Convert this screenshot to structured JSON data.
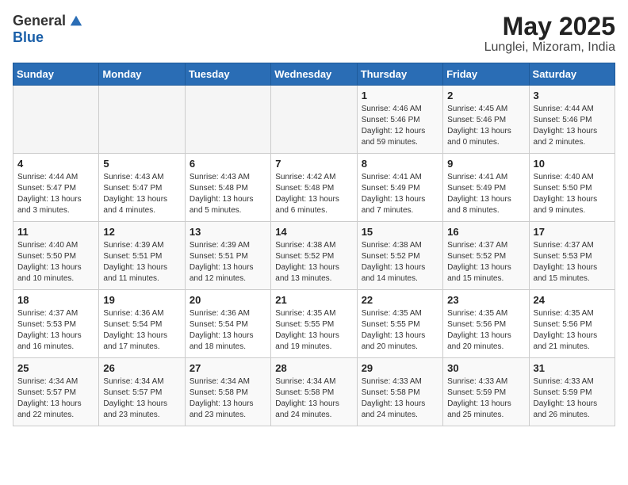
{
  "header": {
    "logo_general": "General",
    "logo_blue": "Blue",
    "month_title": "May 2025",
    "location": "Lunglei, Mizoram, India"
  },
  "weekdays": [
    "Sunday",
    "Monday",
    "Tuesday",
    "Wednesday",
    "Thursday",
    "Friday",
    "Saturday"
  ],
  "weeks": [
    [
      {
        "day": "",
        "info": ""
      },
      {
        "day": "",
        "info": ""
      },
      {
        "day": "",
        "info": ""
      },
      {
        "day": "",
        "info": ""
      },
      {
        "day": "1",
        "info": "Sunrise: 4:46 AM\nSunset: 5:46 PM\nDaylight: 12 hours\nand 59 minutes."
      },
      {
        "day": "2",
        "info": "Sunrise: 4:45 AM\nSunset: 5:46 PM\nDaylight: 13 hours\nand 0 minutes."
      },
      {
        "day": "3",
        "info": "Sunrise: 4:44 AM\nSunset: 5:46 PM\nDaylight: 13 hours\nand 2 minutes."
      }
    ],
    [
      {
        "day": "4",
        "info": "Sunrise: 4:44 AM\nSunset: 5:47 PM\nDaylight: 13 hours\nand 3 minutes."
      },
      {
        "day": "5",
        "info": "Sunrise: 4:43 AM\nSunset: 5:47 PM\nDaylight: 13 hours\nand 4 minutes."
      },
      {
        "day": "6",
        "info": "Sunrise: 4:43 AM\nSunset: 5:48 PM\nDaylight: 13 hours\nand 5 minutes."
      },
      {
        "day": "7",
        "info": "Sunrise: 4:42 AM\nSunset: 5:48 PM\nDaylight: 13 hours\nand 6 minutes."
      },
      {
        "day": "8",
        "info": "Sunrise: 4:41 AM\nSunset: 5:49 PM\nDaylight: 13 hours\nand 7 minutes."
      },
      {
        "day": "9",
        "info": "Sunrise: 4:41 AM\nSunset: 5:49 PM\nDaylight: 13 hours\nand 8 minutes."
      },
      {
        "day": "10",
        "info": "Sunrise: 4:40 AM\nSunset: 5:50 PM\nDaylight: 13 hours\nand 9 minutes."
      }
    ],
    [
      {
        "day": "11",
        "info": "Sunrise: 4:40 AM\nSunset: 5:50 PM\nDaylight: 13 hours\nand 10 minutes."
      },
      {
        "day": "12",
        "info": "Sunrise: 4:39 AM\nSunset: 5:51 PM\nDaylight: 13 hours\nand 11 minutes."
      },
      {
        "day": "13",
        "info": "Sunrise: 4:39 AM\nSunset: 5:51 PM\nDaylight: 13 hours\nand 12 minutes."
      },
      {
        "day": "14",
        "info": "Sunrise: 4:38 AM\nSunset: 5:52 PM\nDaylight: 13 hours\nand 13 minutes."
      },
      {
        "day": "15",
        "info": "Sunrise: 4:38 AM\nSunset: 5:52 PM\nDaylight: 13 hours\nand 14 minutes."
      },
      {
        "day": "16",
        "info": "Sunrise: 4:37 AM\nSunset: 5:52 PM\nDaylight: 13 hours\nand 15 minutes."
      },
      {
        "day": "17",
        "info": "Sunrise: 4:37 AM\nSunset: 5:53 PM\nDaylight: 13 hours\nand 15 minutes."
      }
    ],
    [
      {
        "day": "18",
        "info": "Sunrise: 4:37 AM\nSunset: 5:53 PM\nDaylight: 13 hours\nand 16 minutes."
      },
      {
        "day": "19",
        "info": "Sunrise: 4:36 AM\nSunset: 5:54 PM\nDaylight: 13 hours\nand 17 minutes."
      },
      {
        "day": "20",
        "info": "Sunrise: 4:36 AM\nSunset: 5:54 PM\nDaylight: 13 hours\nand 18 minutes."
      },
      {
        "day": "21",
        "info": "Sunrise: 4:35 AM\nSunset: 5:55 PM\nDaylight: 13 hours\nand 19 minutes."
      },
      {
        "day": "22",
        "info": "Sunrise: 4:35 AM\nSunset: 5:55 PM\nDaylight: 13 hours\nand 20 minutes."
      },
      {
        "day": "23",
        "info": "Sunrise: 4:35 AM\nSunset: 5:56 PM\nDaylight: 13 hours\nand 20 minutes."
      },
      {
        "day": "24",
        "info": "Sunrise: 4:35 AM\nSunset: 5:56 PM\nDaylight: 13 hours\nand 21 minutes."
      }
    ],
    [
      {
        "day": "25",
        "info": "Sunrise: 4:34 AM\nSunset: 5:57 PM\nDaylight: 13 hours\nand 22 minutes."
      },
      {
        "day": "26",
        "info": "Sunrise: 4:34 AM\nSunset: 5:57 PM\nDaylight: 13 hours\nand 23 minutes."
      },
      {
        "day": "27",
        "info": "Sunrise: 4:34 AM\nSunset: 5:58 PM\nDaylight: 13 hours\nand 23 minutes."
      },
      {
        "day": "28",
        "info": "Sunrise: 4:34 AM\nSunset: 5:58 PM\nDaylight: 13 hours\nand 24 minutes."
      },
      {
        "day": "29",
        "info": "Sunrise: 4:33 AM\nSunset: 5:58 PM\nDaylight: 13 hours\nand 24 minutes."
      },
      {
        "day": "30",
        "info": "Sunrise: 4:33 AM\nSunset: 5:59 PM\nDaylight: 13 hours\nand 25 minutes."
      },
      {
        "day": "31",
        "info": "Sunrise: 4:33 AM\nSunset: 5:59 PM\nDaylight: 13 hours\nand 26 minutes."
      }
    ]
  ]
}
